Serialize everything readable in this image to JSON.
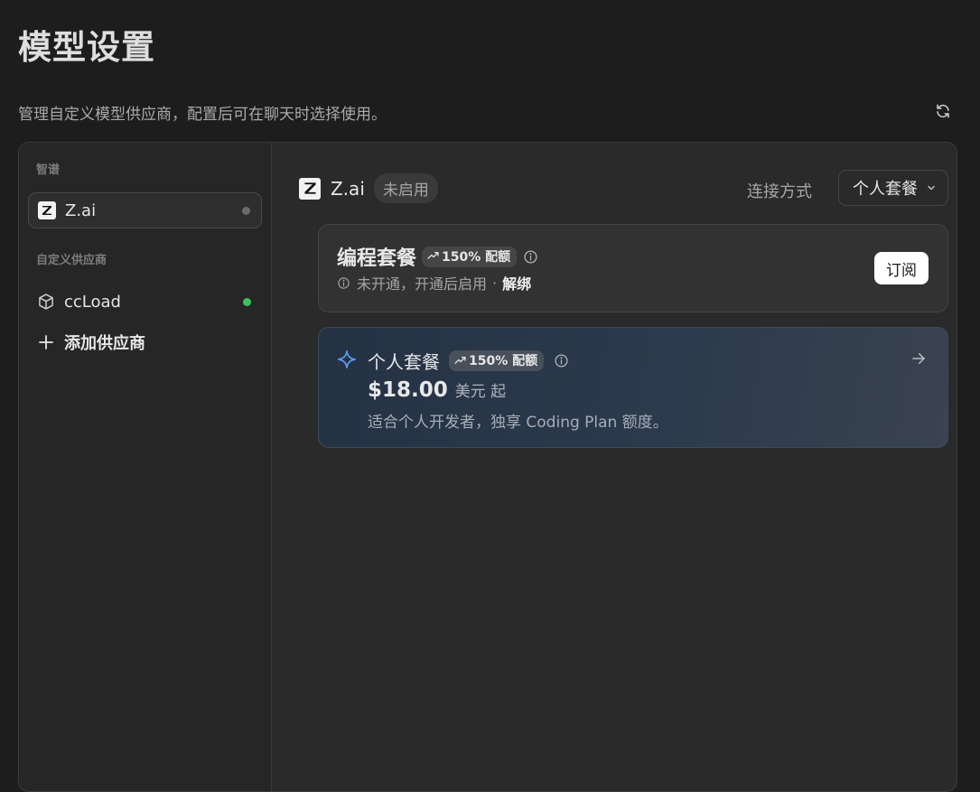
{
  "header": {
    "title": "模型设置",
    "description": "管理自定义模型供应商，配置后可在聊天时选择使用。"
  },
  "sidebar": {
    "groups": [
      {
        "label": "智谱",
        "items": [
          {
            "label": "Z.ai",
            "icon": "z-logo-icon",
            "status": "inactive",
            "status_color": "#6b6b6b"
          }
        ]
      },
      {
        "label": "自定义供应商",
        "items": [
          {
            "label": "ccLoad",
            "icon": "cube-icon",
            "status": "active",
            "status_color": "#3fbf5f"
          }
        ]
      }
    ],
    "add_provider_label": "添加供应商"
  },
  "provider": {
    "name": "Z.ai",
    "status_badge": "未启用",
    "connection_label": "连接方式",
    "connection_value": "个人套餐"
  },
  "plans": {
    "coding": {
      "title": "编程套餐",
      "quota_badge": "150% 配额",
      "status_text": "未开通，开通后启用",
      "separator": "·",
      "unbind_label": "解绑",
      "subscribe_label": "订阅"
    },
    "personal": {
      "title": "个人套餐",
      "quota_badge": "150% 配额",
      "price": "$18.00",
      "price_unit": "美元 起",
      "description": "适合个人开发者，独享 Coding Plan 额度。"
    }
  },
  "colors": {
    "accent_blue": "#5b9cf0",
    "active_green": "#3fbf5f"
  }
}
